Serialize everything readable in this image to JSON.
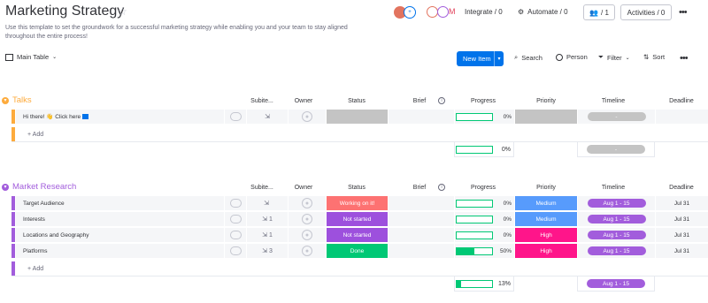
{
  "header": {
    "title": "Marketing Strategy",
    "description": "Use this template to set the groundwork for a successful marketing strategy while enabling you and your team to stay aligned throughout the entire process!",
    "integrate_label": "Integrate / 0",
    "automate_label": "Automate / 0",
    "members_count": "/ 1",
    "activities_label": "Activities / 0",
    "more_label": "•••"
  },
  "toolbar": {
    "main_table_label": "Main Table",
    "new_item_label": "New Item",
    "search_label": "Search",
    "person_label": "Person",
    "filter_label": "Filter",
    "sort_label": "Sort",
    "more_label": "•••"
  },
  "columns": {
    "subitems": "Subite...",
    "owner": "Owner",
    "status": "Status",
    "brief": "Brief",
    "progress": "Progress",
    "priority": "Priority",
    "timeline": "Timeline",
    "deadline": "Deadline"
  },
  "colors": {
    "talks": "#fdab3d",
    "market": "#a25ddc",
    "working": "#fd7272",
    "not_started": "#9d50dd",
    "done": "#00c875",
    "medium": "#579bfc",
    "high": "#ff158a",
    "grey": "#c4c4c4",
    "timeline": "#a25ddc"
  },
  "groups": [
    {
      "name": "Talks",
      "rows": [
        {
          "name": "Hi there! 👋 Click here",
          "subitems": "",
          "status": "",
          "progress": 0,
          "progress_label": "0%",
          "priority": "",
          "timeline": "-",
          "deadline": ""
        }
      ],
      "add_label": "+ Add",
      "summary": {
        "progress": 0,
        "progress_label": "0%",
        "timeline": "-"
      }
    },
    {
      "name": "Market Research",
      "rows": [
        {
          "name": "Target Audience",
          "subitems": "",
          "status": "Working on it!",
          "progress": 0,
          "progress_label": "0%",
          "priority": "Medium",
          "timeline": "Aug 1 - 15",
          "deadline": "Jul 31"
        },
        {
          "name": "Interests",
          "subitems": "1",
          "status": "Not started",
          "progress": 0,
          "progress_label": "0%",
          "priority": "Medium",
          "timeline": "Aug 1 - 15",
          "deadline": "Jul 31"
        },
        {
          "name": "Locations and Geography",
          "subitems": "1",
          "status": "Not started",
          "progress": 0,
          "progress_label": "0%",
          "priority": "High",
          "timeline": "Aug 1 - 15",
          "deadline": "Jul 31"
        },
        {
          "name": "Platforms",
          "subitems": "3",
          "status": "Done",
          "progress": 50,
          "progress_label": "50%",
          "priority": "High",
          "timeline": "Aug 1 - 15",
          "deadline": "Jul 31"
        }
      ],
      "add_label": "+ Add",
      "summary": {
        "progress": 13,
        "progress_label": "13%",
        "timeline": "Aug 1 - 15"
      }
    }
  ]
}
